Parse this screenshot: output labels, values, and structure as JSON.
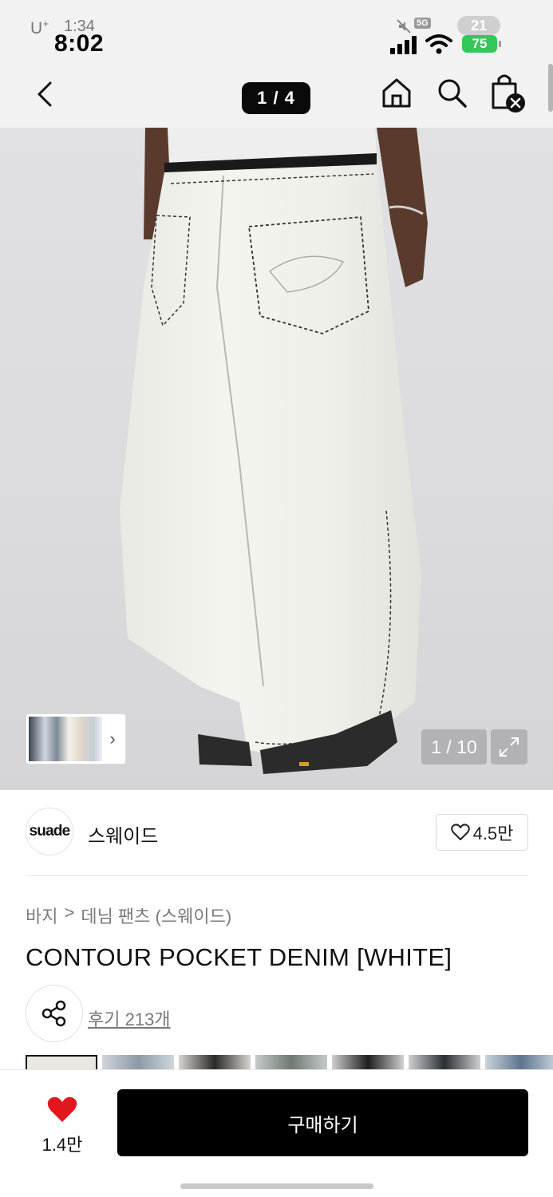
{
  "status_bar": {
    "carrier": "U",
    "carrier_sup": "+",
    "carrier_time": "1:34",
    "time": "8:02",
    "network": "5G",
    "ghost_badge": "21",
    "battery": "75"
  },
  "header": {
    "page_counter": "1 / 4",
    "icons": [
      "back-arrow-icon",
      "home-icon",
      "search-icon",
      "shopping-bag-icon"
    ]
  },
  "gallery": {
    "image_counter": "1 / 10",
    "thumb_arrow": "›"
  },
  "brand": {
    "logo_text": "suade",
    "name": "스웨이드",
    "likes": "4.5만"
  },
  "product": {
    "breadcrumb": [
      "바지",
      ">",
      "데님 팬츠 (스웨이드)"
    ],
    "title": "CONTOUR POCKET DENIM [WHITE]",
    "reviews": "후기 213개"
  },
  "bottom_bar": {
    "wish_count": "1.4만",
    "buy_label": "구매하기"
  },
  "colors": {
    "accent": "#e4161d",
    "buy_button": "#000000",
    "battery": "#34c759"
  }
}
